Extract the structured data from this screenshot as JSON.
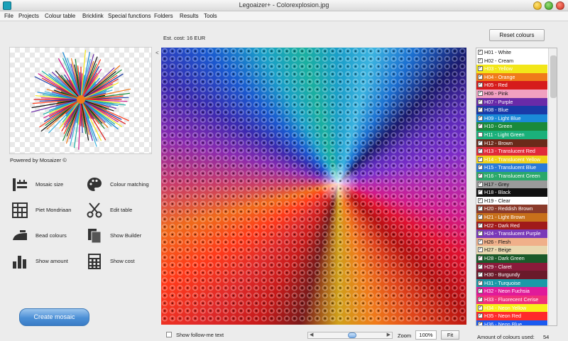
{
  "window": {
    "title": "Legoaizer+  -  Colorexplosion.jpg"
  },
  "menu": [
    "File",
    "Projects",
    "Colour table",
    "Bricklink",
    "Special functions",
    "Folders",
    "Results",
    "Tools"
  ],
  "est_cost": "Est. cost:  16 EUR",
  "reset_label": "Reset colours",
  "powered_by": "Powered by Mosaizer ©",
  "tools": [
    {
      "label": "Mosaic size",
      "icon": "ruler-icon"
    },
    {
      "label": "Colour matching",
      "icon": "palette-icon"
    },
    {
      "label": "Piet Mondriaan",
      "icon": "grid-icon"
    },
    {
      "label": "Edit table",
      "icon": "scissors-icon"
    },
    {
      "label": "Bead colours",
      "icon": "iron-icon"
    },
    {
      "label": "Show Builder",
      "icon": "documents-icon"
    },
    {
      "label": "Show amount",
      "icon": "bar-chart-icon"
    },
    {
      "label": "Show cost",
      "icon": "calculator-icon"
    }
  ],
  "create_label": "Create mosaic",
  "follow_me": "Show follow-me text",
  "zoom": {
    "label": "Zoom",
    "value": "100%",
    "fit_label": "Fit",
    "slider_level": 0.5
  },
  "amount_label": "Amount of colours used:",
  "amount_value": "54",
  "colours": [
    {
      "label": "H01 - White",
      "bg": "#ffffff",
      "fg": "#111111",
      "checked": true
    },
    {
      "label": "H02 - Cream",
      "bg": "#ffffff",
      "fg": "#111111",
      "checked": true
    },
    {
      "label": "H03 - Yellow",
      "bg": "#f2e619",
      "fg": "#ffffff",
      "checked": true
    },
    {
      "label": "H04 - Orange",
      "bg": "#f07a1a",
      "fg": "#ffffff",
      "checked": true
    },
    {
      "label": "H05 - Red",
      "bg": "#d61c1c",
      "fg": "#ffffff",
      "checked": true
    },
    {
      "label": "H06 - Pink",
      "bg": "#f0a0c0",
      "fg": "#111111",
      "checked": true
    },
    {
      "label": "H07 - Purple",
      "bg": "#6a2aa8",
      "fg": "#ffffff",
      "checked": true
    },
    {
      "label": "H08 - Blue",
      "bg": "#1a3aa8",
      "fg": "#ffffff",
      "checked": true
    },
    {
      "label": "H09 - Light Blue",
      "bg": "#1a8ad8",
      "fg": "#ffffff",
      "checked": true
    },
    {
      "label": "H10 - Green",
      "bg": "#1a8a3a",
      "fg": "#ffffff",
      "checked": true
    },
    {
      "label": "H11 - Light Green",
      "bg": "#1ab07a",
      "fg": "#ffffff",
      "checked": false
    },
    {
      "label": "H12 - Brown",
      "bg": "#6a2a1a",
      "fg": "#ffffff",
      "checked": true
    },
    {
      "label": "H13 - Translucent Red",
      "bg": "#e02a3a",
      "fg": "#ffffff",
      "checked": true
    },
    {
      "label": "H14 - Translucent Yellow",
      "bg": "#f0d21a",
      "fg": "#ffffff",
      "checked": true
    },
    {
      "label": "H15 - Translucent Blue",
      "bg": "#2a7ad8",
      "fg": "#ffffff",
      "checked": true
    },
    {
      "label": "H16 - Translucent Green",
      "bg": "#2aa86a",
      "fg": "#ffffff",
      "checked": true
    },
    {
      "label": "H17 - Grey",
      "bg": "#9a9a9a",
      "fg": "#111111",
      "checked": true
    },
    {
      "label": "H18 - Black",
      "bg": "#111111",
      "fg": "#ffffff",
      "checked": true
    },
    {
      "label": "H19 - Clear",
      "bg": "#ffffff",
      "fg": "#111111",
      "checked": true
    },
    {
      "label": "H20 - Reddish Brown",
      "bg": "#8a3a2a",
      "fg": "#ffffff",
      "checked": true
    },
    {
      "label": "H21 - Light Brown",
      "bg": "#c8701a",
      "fg": "#ffffff",
      "checked": true
    },
    {
      "label": "H22 - Dark Red",
      "bg": "#a01a1a",
      "fg": "#ffffff",
      "checked": true
    },
    {
      "label": "H24 - Translucent Purple",
      "bg": "#7a3ab8",
      "fg": "#ffffff",
      "checked": true
    },
    {
      "label": "H26 - Flesh",
      "bg": "#f0b08a",
      "fg": "#111111",
      "checked": true
    },
    {
      "label": "H27 - Beige",
      "bg": "#e8d8b0",
      "fg": "#111111",
      "checked": true
    },
    {
      "label": "H28 - Dark Green",
      "bg": "#1a5a2a",
      "fg": "#ffffff",
      "checked": true
    },
    {
      "label": "H29 - Claret",
      "bg": "#8a1a3a",
      "fg": "#ffffff",
      "checked": true
    },
    {
      "label": "H30 - Burgundy",
      "bg": "#6a1a2a",
      "fg": "#ffffff",
      "checked": true
    },
    {
      "label": "H31 - Turquoise",
      "bg": "#1a9aa8",
      "fg": "#ffffff",
      "checked": true
    },
    {
      "label": "H32 - Neon Fuchsia",
      "bg": "#e01a9a",
      "fg": "#ffffff",
      "checked": true
    },
    {
      "label": "H33 - Fluorecent Cerise",
      "bg": "#f0307a",
      "fg": "#ffffff",
      "checked": true
    },
    {
      "label": "H34 - Neon Yellow",
      "bg": "#f8f01a",
      "fg": "#ffffff",
      "checked": true
    },
    {
      "label": "H35 - Neon Red",
      "bg": "#ff2a2a",
      "fg": "#ffffff",
      "checked": true
    },
    {
      "label": "H36 - Neon Blue",
      "bg": "#1a5af0",
      "fg": "#ffffff",
      "checked": true
    }
  ]
}
